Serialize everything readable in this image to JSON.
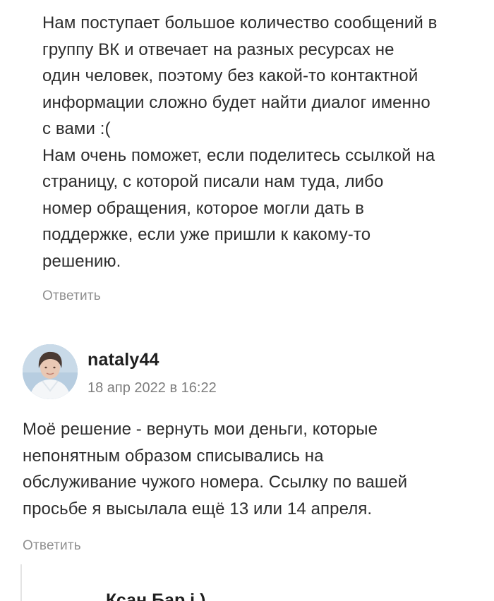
{
  "reply": {
    "text": "Нам поступает большое количество сообщений в\nгруппу ВК и отвечает на разных ресурсах не\nодин человек, поэтому без какой-то контактной\nинформации сложно будет найти диалог именно\nс вами :(\nНам очень поможет, если поделитесь ссылкой на\nстраницу, с которой писали нам туда, либо\nномер обращения, которое могли дать в\nподдержке, если уже пришли к какому-то\nрешению.",
    "reply_label": "Ответить"
  },
  "comment": {
    "author": "nataly44",
    "date": "18 апр 2022 в 16:22",
    "text": "Моё решение - вернуть мои деньги, которые\nнепонятным образом списывались на\nобслуживание чужого номера. Ссылку по вашей\nпросьбе я высылала ещё 13 или 14 апреля.",
    "reply_label": "Ответить",
    "avatar_icon": "user-photo-avatar"
  },
  "next_reply": {
    "author_partial": "Ксан Бар  і  )"
  }
}
